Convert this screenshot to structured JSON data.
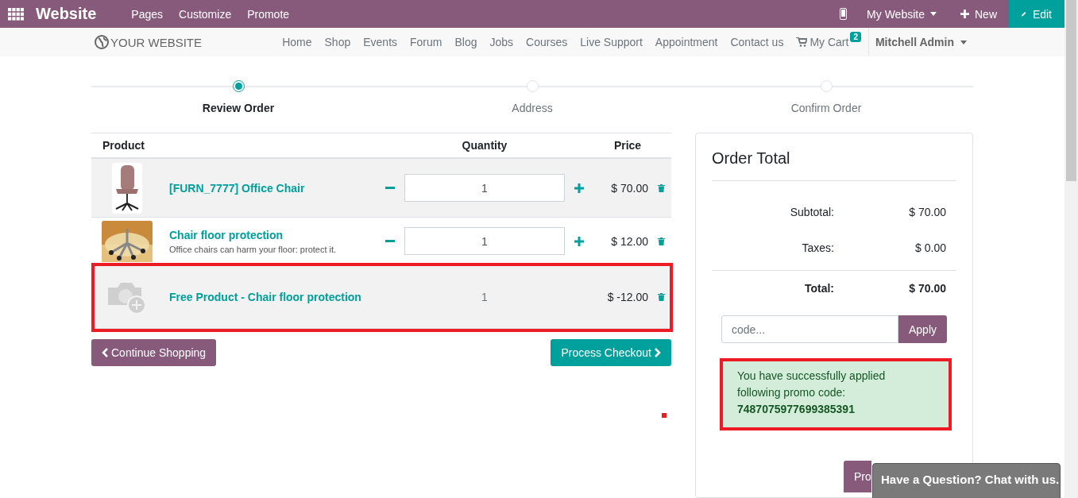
{
  "topbar": {
    "title": "Website",
    "menu": [
      "Pages",
      "Customize",
      "Promote"
    ],
    "website_switcher": "My Website",
    "new_button": "New",
    "edit_button": "Edit"
  },
  "navbar": {
    "logo": "YOUR WEBSITE",
    "links": [
      "Home",
      "Shop",
      "Events",
      "Forum",
      "Blog",
      "Jobs",
      "Courses",
      "Live Support",
      "Appointment",
      "Contact us"
    ],
    "cart": {
      "label": "My Cart",
      "count": "2"
    },
    "user": "Mitchell Admin"
  },
  "steps": [
    {
      "label": "Review Order",
      "selected": true
    },
    {
      "label": "Address",
      "selected": false
    },
    {
      "label": "Confirm Order",
      "selected": false
    }
  ],
  "cart_table": {
    "columns": [
      "Product",
      "Quantity",
      "Price"
    ],
    "rows": [
      {
        "kind": "product",
        "name": "[FURN_7777] Office Chair",
        "quantity": "1",
        "price": "$ 70.00",
        "highlighted": false
      },
      {
        "kind": "product",
        "name": "Chair floor protection",
        "description": "Office chairs can harm your floor: protect it.",
        "quantity": "1",
        "price": "$ 12.00",
        "highlighted": false
      },
      {
        "kind": "reward",
        "name": "Free Product - Chair floor protection",
        "quantity": "1",
        "price": "$ -12.00",
        "highlighted": true
      }
    ]
  },
  "continue_button": "Continue Shopping",
  "checkout_button": "Process Checkout",
  "summary": {
    "title": "Order Total",
    "lines": [
      {
        "kind": "normal",
        "label": "Subtotal:",
        "value": "$ 70.00"
      },
      {
        "kind": "normal",
        "label": "Taxes:",
        "value": "$ 0.00"
      },
      {
        "kind": "total",
        "label": "Total:",
        "value": "$ 70.00"
      }
    ],
    "promo": {
      "placeholder": "code...",
      "button": "Apply"
    },
    "alert": {
      "text": "You have successfully applied following promo code:",
      "code": "7487075977699385391",
      "highlighted": true
    },
    "checkout_button": "Pro"
  },
  "chat": {
    "label": "Have a Question? Chat with us."
  }
}
